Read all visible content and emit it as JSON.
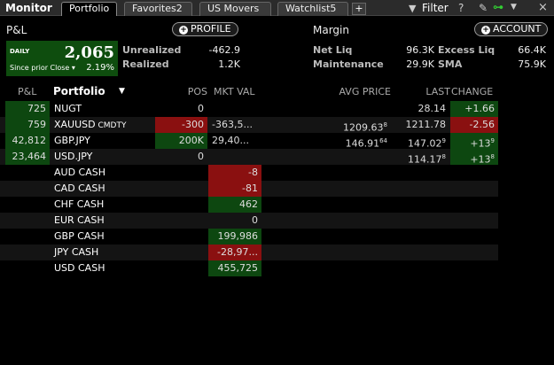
{
  "window": {
    "title": "Monitor"
  },
  "tabs": [
    {
      "label": "Portfolio",
      "active": true
    },
    {
      "label": "Favorites2",
      "active": false
    },
    {
      "label": "US Movers",
      "active": false
    },
    {
      "label": "Watchlist5",
      "active": false
    }
  ],
  "tab_add": "+",
  "toolbar": {
    "filter_label": "Filter",
    "help": "?"
  },
  "pnl": {
    "section_label": "P&L",
    "profile_button": "PROFILE",
    "period": "DAILY",
    "value": "2,065",
    "since_label": "Since prior Close ▾",
    "change_pct": "2.19%",
    "unrealized_label": "Unrealized",
    "unrealized_value": "-462.9",
    "realized_label": "Realized",
    "realized_value": "1.2K"
  },
  "margin": {
    "section_label": "Margin",
    "account_button": "ACCOUNT",
    "net_liq_label": "Net Liq",
    "net_liq_value": "96.3K",
    "excess_liq_label": "Excess Liq",
    "excess_liq_value": "66.4K",
    "maintenance_label": "Maintenance",
    "maintenance_value": "29.9K",
    "sma_label": "SMA",
    "sma_value": "75.9K"
  },
  "table": {
    "headers": {
      "pnl": "P&L",
      "portfolio": "Portfolio",
      "pos": "POS",
      "mkt_val": "MKT VAL",
      "avg_price": "AVG PRICE",
      "last": "LAST",
      "change": "CHANGE"
    },
    "rows": [
      {
        "pnl": "725",
        "name": "NUGT",
        "sub": "",
        "pos": "0",
        "mkt": "",
        "avg": "",
        "avg_sup": "",
        "last": "28.14",
        "last_sup": "",
        "chg": "+1.66",
        "chg_sup": ""
      },
      {
        "pnl": "759",
        "name": "XAUUSD",
        "sub": "CMDTY",
        "pos": "-300",
        "mkt": "-363,5...",
        "avg": "1209.63",
        "avg_sup": "8",
        "last": "1211.78",
        "last_sup": "",
        "chg": "-2.56",
        "chg_sup": ""
      },
      {
        "pnl": "42,812",
        "name": "GBP.JPY",
        "sub": "",
        "pos": "200K",
        "mkt": "29,40...",
        "avg": "146.91",
        "avg_sup": "64",
        "last": "147.02",
        "last_sup": "9",
        "chg": "+13",
        "chg_sup": "9"
      },
      {
        "pnl": "23,464",
        "name": "USD.JPY",
        "sub": "",
        "pos": "0",
        "mkt": "",
        "avg": "",
        "avg_sup": "",
        "last": "114.17",
        "last_sup": "8",
        "chg": "+13",
        "chg_sup": "8"
      },
      {
        "pnl": "",
        "name": "AUD CASH",
        "sub": "",
        "pos": "",
        "mkt": "-8",
        "avg": "",
        "avg_sup": "",
        "last": "",
        "last_sup": "",
        "chg": "",
        "chg_sup": ""
      },
      {
        "pnl": "",
        "name": "CAD CASH",
        "sub": "",
        "pos": "",
        "mkt": "-81",
        "avg": "",
        "avg_sup": "",
        "last": "",
        "last_sup": "",
        "chg": "",
        "chg_sup": ""
      },
      {
        "pnl": "",
        "name": "CHF CASH",
        "sub": "",
        "pos": "",
        "mkt": "462",
        "avg": "",
        "avg_sup": "",
        "last": "",
        "last_sup": "",
        "chg": "",
        "chg_sup": ""
      },
      {
        "pnl": "",
        "name": "EUR CASH",
        "sub": "",
        "pos": "",
        "mkt": "0",
        "avg": "",
        "avg_sup": "",
        "last": "",
        "last_sup": "",
        "chg": "",
        "chg_sup": ""
      },
      {
        "pnl": "",
        "name": "GBP CASH",
        "sub": "",
        "pos": "",
        "mkt": "199,986",
        "avg": "",
        "avg_sup": "",
        "last": "",
        "last_sup": "",
        "chg": "",
        "chg_sup": ""
      },
      {
        "pnl": "",
        "name": "JPY CASH",
        "sub": "",
        "pos": "",
        "mkt": "-28,97...",
        "avg": "",
        "avg_sup": "",
        "last": "",
        "last_sup": "",
        "chg": "",
        "chg_sup": ""
      },
      {
        "pnl": "",
        "name": "USD CASH",
        "sub": "",
        "pos": "",
        "mkt": "455,725",
        "avg": "",
        "avg_sup": "",
        "last": "",
        "last_sup": "",
        "chg": "",
        "chg_sup": ""
      }
    ]
  },
  "colors": {
    "positive_bg": "#0d4710",
    "negative_bg": "#8a1010",
    "pnl_box": "#0e4d0e",
    "link_icon": "#33cc33"
  },
  "icons": {
    "filter": "funnel-icon",
    "help": "question-icon",
    "pin": "pin-icon",
    "link": "link-icon",
    "close": "close-icon"
  }
}
